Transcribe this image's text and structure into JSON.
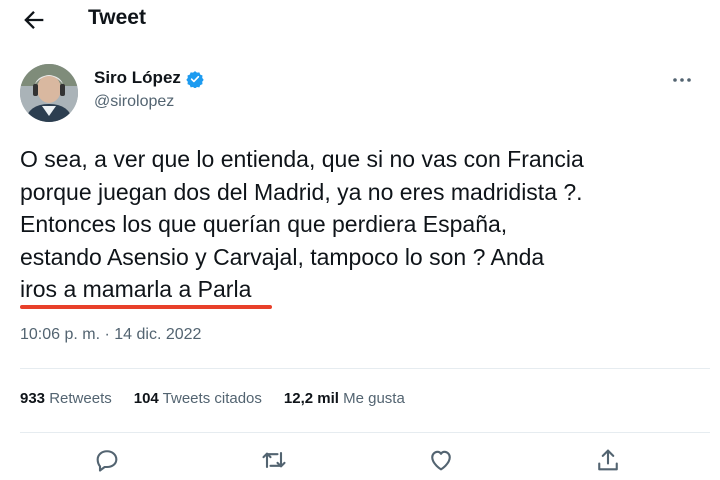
{
  "header": {
    "title": "Tweet"
  },
  "author": {
    "name": "Siro López",
    "handle": "@sirolopez",
    "verified": true
  },
  "tweet": {
    "lines": [
      "O sea, a ver que lo entienda, que si no vas con Francia",
      "porque juegan dos del Madrid, ya no eres madridista ?.",
      "Entonces los que querían que perdiera España,",
      "estando Asensio y Carvajal, tampoco lo son ? Anda",
      "iros a mamarla a Parla"
    ],
    "timestamp": "10:06 p. m. · 14 dic. 2022"
  },
  "stats": {
    "retweets": {
      "count": "933",
      "label": "Retweets"
    },
    "quotes": {
      "count": "104",
      "label": "Tweets citados"
    },
    "likes": {
      "count": "12,2 mil",
      "label": "Me gusta"
    }
  },
  "icons": {
    "back": "back-arrow-icon",
    "verified": "verified-badge-icon",
    "more": "more-options-icon",
    "reply": "reply-icon",
    "retweet": "retweet-icon",
    "like": "like-icon",
    "share": "share-icon"
  },
  "colors": {
    "text": "#0f1419",
    "secondary": "#536471",
    "verified": "#1d9bf0",
    "annotation_underline": "#e8402a",
    "divider": "#e6ecf0"
  }
}
